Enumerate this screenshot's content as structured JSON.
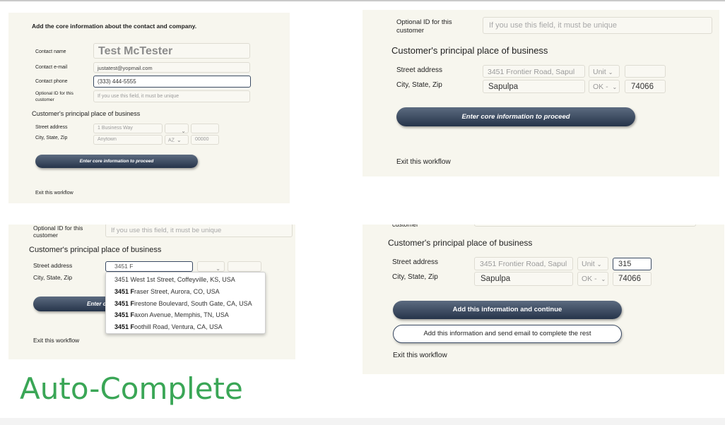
{
  "panel_a": {
    "heading": "Add the core information about the contact and company.",
    "contact_name_label": "Contact name",
    "contact_name_value": "Test McTester",
    "contact_email_label": "Contact e-mail",
    "contact_email_value": "justatest@yopmail.com",
    "contact_phone_label": "Contact phone",
    "contact_phone_value": "(333) 444-5555",
    "optional_id_label": "Optional ID for this customer",
    "optional_id_placeholder": "If you use this field, it must be unique",
    "business_heading": "Customer's principal place of business",
    "street_label": "Street address",
    "street_placeholder": "1 Business Way",
    "city_label": "City, State, Zip",
    "city_placeholder": "Anytown",
    "state_value": "AZ",
    "zip_placeholder": "00000",
    "proceed_button": "Enter core information to proceed",
    "exit_link": "Exit this workflow"
  },
  "panel_b": {
    "optional_id_label": "Optional ID for this customer",
    "optional_id_placeholder": "If you use this field, it must be unique",
    "business_heading": "Customer's principal place of business",
    "street_label": "Street address",
    "street_value": "3451 Frontier Road, Sapul",
    "unit_value": "Unit",
    "city_label": "City, State, Zip",
    "city_value": "Sapulpa",
    "state_value": "OK - ",
    "zip_value": "74066",
    "proceed_button": "Enter core information to proceed",
    "exit_link": "Exit this workflow"
  },
  "panel_c": {
    "optional_id_label": "Optional ID for this customer",
    "optional_id_placeholder": "If you use this field, it must be unique",
    "business_heading": "Customer's principal place of business",
    "street_label": "Street address",
    "street_value": "3451 F",
    "city_label": "City, State, Zip",
    "proceed_button_partial": "Enter c",
    "exit_link": "Exit this workflow",
    "suggestions": [
      {
        "bold": "",
        "rest": "3451 West 1st Street, Coffeyville, KS, USA"
      },
      {
        "bold": "3451 F",
        "rest": "raser Street, Aurora, CO, USA"
      },
      {
        "bold": "3451 F",
        "rest": "irestone Boulevard, South Gate, CA, USA"
      },
      {
        "bold": "3451 F",
        "rest": "axon Avenue, Memphis, TN, USA"
      },
      {
        "bold": "3451 F",
        "rest": "oothill Road, Ventura, CA, USA"
      }
    ]
  },
  "panel_d": {
    "cut_label": "customer",
    "business_heading": "Customer's principal place of business",
    "street_label": "Street address",
    "street_value": "3451 Frontier Road, Sapul",
    "unit_value": "Unit",
    "unit_number_value": "315",
    "city_label": "City, State, Zip",
    "city_value": "Sapulpa",
    "state_value": "OK - ",
    "zip_value": "74066",
    "continue_button": "Add this information and continue",
    "email_button": "Add this information and send email to complete the rest",
    "exit_link": "Exit this workflow"
  },
  "caption": "Auto-Complete",
  "colors": {
    "panel_bg": "#f7f6ee",
    "button_dark": "#2b3950",
    "caption_green": "#3aa656"
  }
}
